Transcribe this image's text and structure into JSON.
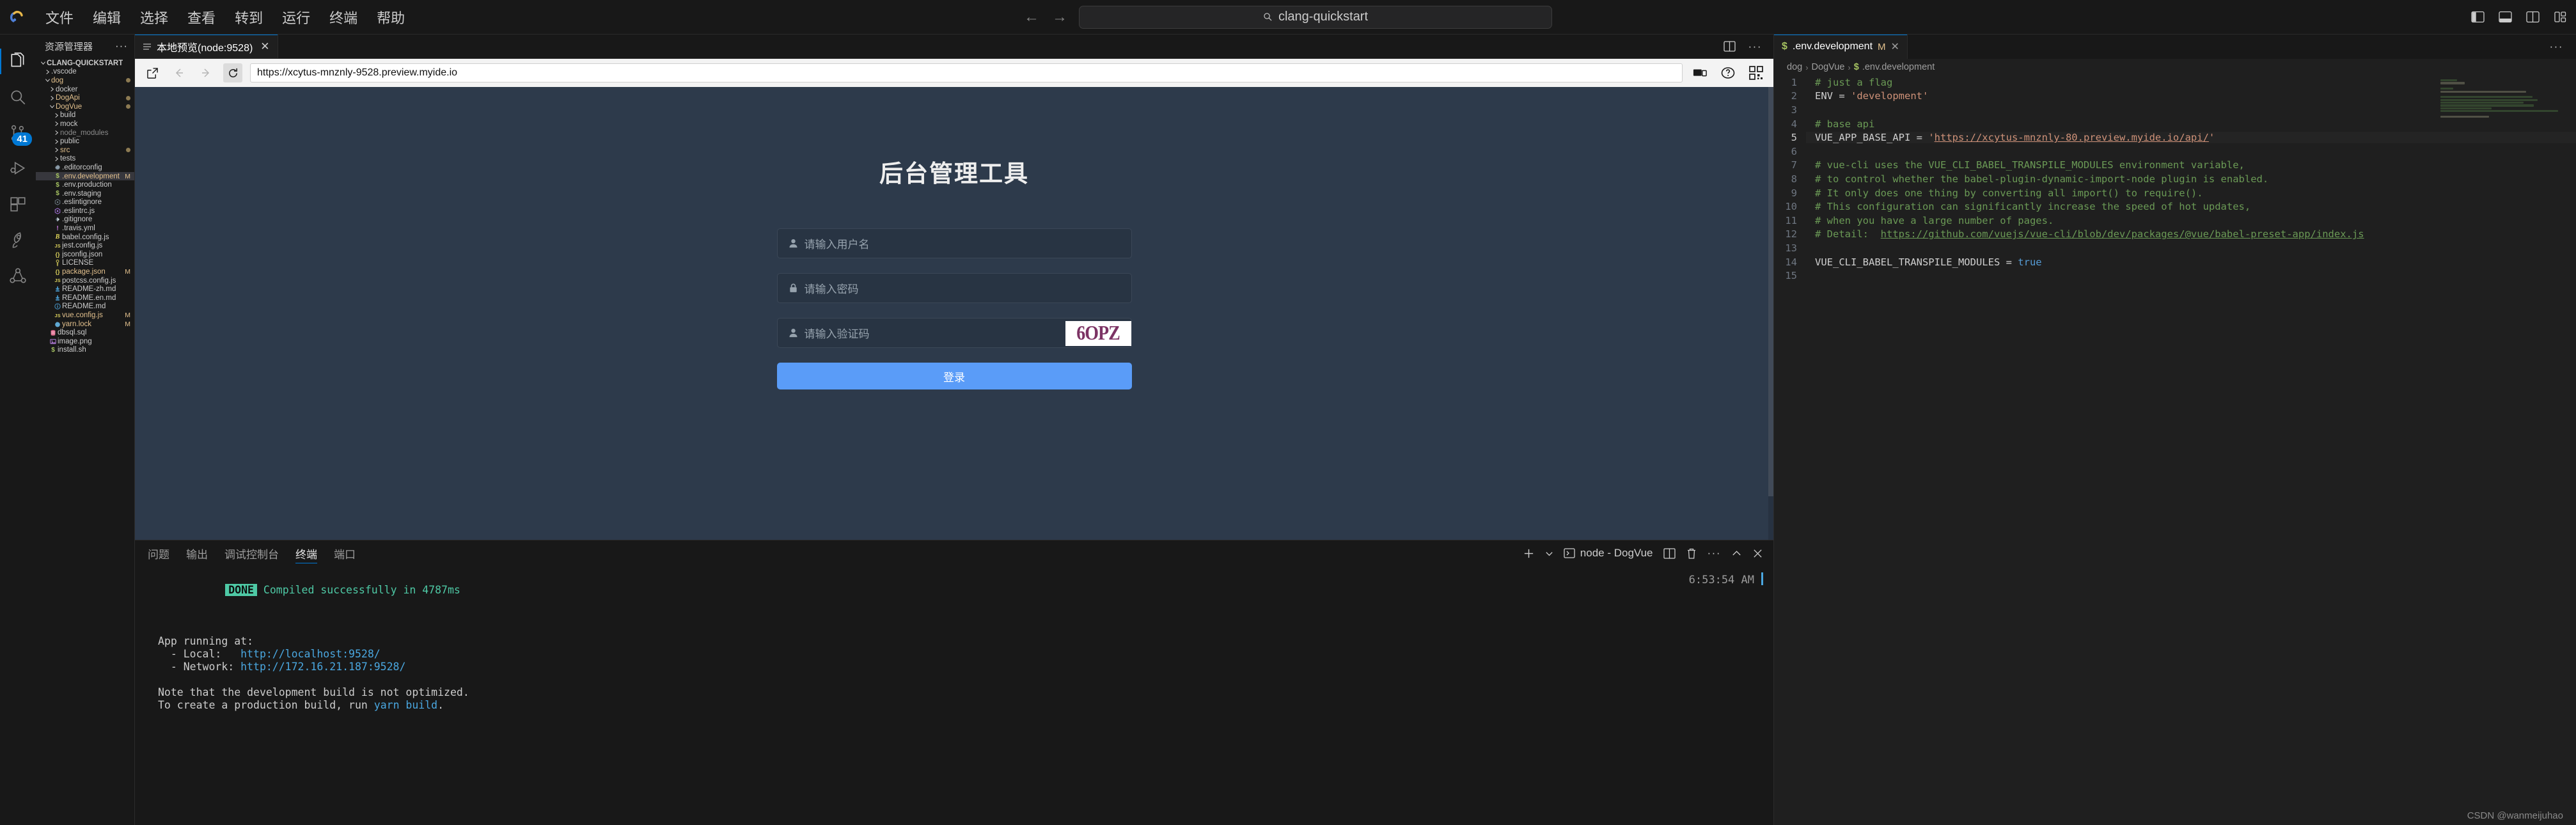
{
  "titlebar": {
    "menus": [
      "文件",
      "编辑",
      "选择",
      "查看",
      "转到",
      "运行",
      "终端",
      "帮助"
    ],
    "search_value": "clang-quickstart",
    "back_icon": "arrow-left-icon",
    "forward_icon": "arrow-right-icon",
    "search_icon": "search-icon",
    "layout_icons": [
      "toggle-primary-sidebar-icon",
      "toggle-panel-icon",
      "toggle-secondary-sidebar-icon",
      "customize-layout-icon"
    ]
  },
  "activitybar": {
    "items": [
      {
        "name": "explorer",
        "icon": "files-icon",
        "active": true,
        "badge": ""
      },
      {
        "name": "search",
        "icon": "search-icon",
        "active": false,
        "badge": ""
      },
      {
        "name": "source-control",
        "icon": "source-control-icon",
        "active": false,
        "badge": "41"
      },
      {
        "name": "run-debug",
        "icon": "run-debug-icon",
        "active": false,
        "badge": ""
      },
      {
        "name": "extensions",
        "icon": "extensions-icon",
        "active": false,
        "badge": ""
      },
      {
        "name": "deploy",
        "icon": "rocket-icon",
        "active": false,
        "badge": ""
      },
      {
        "name": "share",
        "icon": "share-network-icon",
        "active": false,
        "badge": ""
      }
    ]
  },
  "sidebar": {
    "header": "资源管理器",
    "more_icon": "ellipsis-icon",
    "root": "CLANG-QUICKSTART",
    "tree": [
      {
        "label": ".vscode",
        "indent": 1,
        "type": "folder",
        "expanded": false,
        "icon": "chevron-right-icon",
        "color": "white",
        "status": "",
        "dot": ""
      },
      {
        "label": "dog",
        "indent": 1,
        "type": "folder",
        "expanded": true,
        "icon": "chevron-down-icon",
        "color": "orange",
        "status": "",
        "dot": "#8c7a52"
      },
      {
        "label": "docker",
        "indent": 2,
        "type": "folder",
        "expanded": false,
        "icon": "chevron-right-icon",
        "color": "white",
        "status": "",
        "dot": ""
      },
      {
        "label": "DogApi",
        "indent": 2,
        "type": "folder",
        "expanded": false,
        "icon": "chevron-right-icon",
        "color": "orange",
        "status": "",
        "dot": "#8c7a52"
      },
      {
        "label": "DogVue",
        "indent": 2,
        "type": "folder",
        "expanded": true,
        "icon": "chevron-down-icon",
        "color": "orange",
        "status": "",
        "dot": "#8c7a52"
      },
      {
        "label": "build",
        "indent": 3,
        "type": "folder",
        "expanded": false,
        "icon": "chevron-right-icon",
        "color": "white",
        "status": "",
        "dot": ""
      },
      {
        "label": "mock",
        "indent": 3,
        "type": "folder",
        "expanded": false,
        "icon": "chevron-right-icon",
        "color": "white",
        "status": "",
        "dot": ""
      },
      {
        "label": "node_modules",
        "indent": 3,
        "type": "folder",
        "expanded": false,
        "icon": "chevron-right-icon",
        "color": "dim",
        "status": "",
        "dot": ""
      },
      {
        "label": "public",
        "indent": 3,
        "type": "folder",
        "expanded": false,
        "icon": "chevron-right-icon",
        "color": "white",
        "status": "",
        "dot": ""
      },
      {
        "label": "src",
        "indent": 3,
        "type": "folder",
        "expanded": false,
        "icon": "chevron-right-icon",
        "color": "orange",
        "status": "",
        "dot": "#8c7a52"
      },
      {
        "label": "tests",
        "indent": 3,
        "type": "folder",
        "expanded": false,
        "icon": "chevron-right-icon",
        "color": "white",
        "status": "",
        "dot": ""
      },
      {
        "label": ".editorconfig",
        "indent": 3,
        "type": "file",
        "icon": "gear-file-icon",
        "color": "white",
        "status": "",
        "dot": ""
      },
      {
        "label": ".env.development",
        "indent": 3,
        "type": "file",
        "icon": "env-file-icon",
        "color": "orange",
        "status": "M",
        "selected": true,
        "dot": ""
      },
      {
        "label": ".env.production",
        "indent": 3,
        "type": "file",
        "icon": "env-file-icon",
        "color": "white",
        "status": "",
        "dot": ""
      },
      {
        "label": ".env.staging",
        "indent": 3,
        "type": "file",
        "icon": "env-file-icon",
        "color": "white",
        "status": "",
        "dot": ""
      },
      {
        "label": ".eslintignore",
        "indent": 3,
        "type": "file",
        "icon": "eslint-ignore-icon",
        "color": "white",
        "status": "",
        "dot": ""
      },
      {
        "label": ".eslintrc.js",
        "indent": 3,
        "type": "file",
        "icon": "eslint-icon",
        "color": "white",
        "status": "",
        "dot": ""
      },
      {
        "label": ".gitignore",
        "indent": 3,
        "type": "file",
        "icon": "git-icon",
        "color": "white",
        "status": "",
        "dot": ""
      },
      {
        "label": ".travis.yml",
        "indent": 3,
        "type": "file",
        "icon": "travis-icon",
        "color": "white",
        "status": "",
        "dot": ""
      },
      {
        "label": "babel.config.js",
        "indent": 3,
        "type": "file",
        "icon": "babel-icon",
        "color": "white",
        "status": "",
        "dot": ""
      },
      {
        "label": "jest.config.js",
        "indent": 3,
        "type": "file",
        "icon": "js-icon",
        "color": "white",
        "status": "",
        "dot": ""
      },
      {
        "label": "jsconfig.json",
        "indent": 3,
        "type": "file",
        "icon": "json-icon",
        "color": "white",
        "status": "",
        "dot": ""
      },
      {
        "label": "LICENSE",
        "indent": 3,
        "type": "file",
        "icon": "license-icon",
        "color": "white",
        "status": "",
        "dot": ""
      },
      {
        "label": "package.json",
        "indent": 3,
        "type": "file",
        "icon": "json-icon",
        "color": "orange",
        "status": "M",
        "dot": ""
      },
      {
        "label": "postcss.config.js",
        "indent": 3,
        "type": "file",
        "icon": "js-icon",
        "color": "white",
        "status": "",
        "dot": ""
      },
      {
        "label": "README-zh.md",
        "indent": 3,
        "type": "file",
        "icon": "markdown-icon",
        "color": "white",
        "status": "",
        "dot": ""
      },
      {
        "label": "README.en.md",
        "indent": 3,
        "type": "file",
        "icon": "markdown-icon",
        "color": "white",
        "status": "",
        "dot": ""
      },
      {
        "label": "README.md",
        "indent": 3,
        "type": "file",
        "icon": "info-icon",
        "color": "white",
        "status": "",
        "dot": ""
      },
      {
        "label": "vue.config.js",
        "indent": 3,
        "type": "file",
        "icon": "js-icon",
        "color": "orange",
        "status": "M",
        "dot": ""
      },
      {
        "label": "yarn.lock",
        "indent": 3,
        "type": "file",
        "icon": "yarn-icon",
        "color": "orange",
        "status": "M",
        "dot": ""
      },
      {
        "label": "dbsql.sql",
        "indent": 2,
        "type": "file",
        "icon": "database-icon",
        "color": "white",
        "status": "",
        "dot": ""
      },
      {
        "label": "image.png",
        "indent": 2,
        "type": "file",
        "icon": "image-icon",
        "color": "white",
        "status": "",
        "dot": ""
      },
      {
        "label": "install.sh",
        "indent": 2,
        "type": "file",
        "icon": "shell-icon",
        "color": "white",
        "status": "",
        "dot": ""
      }
    ]
  },
  "preview": {
    "tab_label": "本地预览(node:9528)",
    "tab_icon": "preview-list-icon",
    "tab_close_icon": "close-icon",
    "split_icon": "split-editor-icon",
    "more_icon": "ellipsis-icon",
    "toolbar": {
      "open_external_icon": "open-external-icon",
      "back_icon": "arrow-left-icon",
      "forward_icon": "arrow-right-icon",
      "reload_icon": "reload-icon",
      "url": "https://xcytus-mnznly-9528.preview.myide.io",
      "device_icon": "device-toggle-icon",
      "help_icon": "question-circle-icon",
      "qr_icon": "qr-code-icon"
    },
    "page": {
      "title": "后台管理工具",
      "fields": [
        {
          "name": "username",
          "icon": "user-icon",
          "placeholder": "请输入用户名",
          "value": ""
        },
        {
          "name": "password",
          "icon": "lock-icon",
          "placeholder": "请输入密码",
          "value": ""
        },
        {
          "name": "captcha",
          "icon": "user-icon",
          "placeholder": "请输入验证码",
          "value": ""
        }
      ],
      "captcha_text": "6OPZ",
      "submit_label": "登录",
      "accent_color": "#5a9cf8",
      "bg_color": "#2d3a4b"
    }
  },
  "panel": {
    "tabs": [
      {
        "label": "问题",
        "active": false
      },
      {
        "label": "输出",
        "active": false
      },
      {
        "label": "调试控制台",
        "active": false
      },
      {
        "label": "终端",
        "active": true
      },
      {
        "label": "端口",
        "active": false
      }
    ],
    "controls": {
      "add_icon": "plus-icon",
      "dropdown_icon": "chevron-down-icon",
      "terminal_icon": "terminal-icon",
      "terminal_name": "node - DogVue",
      "split_icon": "split-panel-icon",
      "trash_icon": "trash-icon",
      "more_icon": "ellipsis-icon",
      "collapse_icon": "chevron-up-icon",
      "close_icon": "close-icon"
    },
    "terminal": {
      "done_badge": "DONE",
      "done_text": "Compiled successfully in 4787ms",
      "running_label": "App running at:",
      "local_label": "  - Local:   ",
      "local_url": "http://localhost:9528/",
      "network_label": "  - Network: ",
      "network_url": "http://172.16.21.187:9528/",
      "note1": "Note that the development build is not optimized.",
      "note2_pre": "To create a production build, run ",
      "note2_cmd": "yarn build",
      "note2_post": ".",
      "time": "6:53:54 AM"
    }
  },
  "editor": {
    "tab": {
      "label": ".env.development",
      "icon": "env-file-icon",
      "status": "M",
      "close_icon": "close-icon"
    },
    "more_icon": "ellipsis-icon",
    "breadcrumb": [
      "dog",
      "DogVue",
      ".env.development"
    ],
    "current_line": 5,
    "lines": [
      {
        "n": 1,
        "segments": [
          {
            "t": "# just a flag",
            "c": "c-comment"
          }
        ]
      },
      {
        "n": 2,
        "segments": [
          {
            "t": "ENV",
            "c": "c-var"
          },
          {
            "t": " = ",
            "c": "c-op"
          },
          {
            "t": "'development'",
            "c": "c-str"
          }
        ]
      },
      {
        "n": 3,
        "segments": []
      },
      {
        "n": 4,
        "segments": [
          {
            "t": "# base api",
            "c": "c-comment"
          }
        ]
      },
      {
        "n": 5,
        "segments": [
          {
            "t": "VUE_APP_BASE_API",
            "c": "c-var"
          },
          {
            "t": " = ",
            "c": "c-op"
          },
          {
            "t": "'",
            "c": "c-str"
          },
          {
            "t": "https://xcytus-mnznly-80.preview.myide.io/api/",
            "c": "c-link"
          },
          {
            "t": "'",
            "c": "c-str"
          }
        ],
        "modified": true
      },
      {
        "n": 6,
        "segments": []
      },
      {
        "n": 7,
        "segments": [
          {
            "t": "# vue-cli uses the VUE_CLI_BABEL_TRANSPILE_MODULES environment variable,",
            "c": "c-comment"
          }
        ]
      },
      {
        "n": 8,
        "segments": [
          {
            "t": "# to control whether the babel-plugin-dynamic-import-node plugin is enabled.",
            "c": "c-comment"
          }
        ]
      },
      {
        "n": 9,
        "segments": [
          {
            "t": "# It only does one thing by converting all import() to require().",
            "c": "c-comment"
          }
        ]
      },
      {
        "n": 10,
        "segments": [
          {
            "t": "# This configuration can significantly increase the speed of hot updates,",
            "c": "c-comment"
          }
        ]
      },
      {
        "n": 11,
        "segments": [
          {
            "t": "# when you have a large number of pages.",
            "c": "c-comment"
          }
        ]
      },
      {
        "n": 12,
        "segments": [
          {
            "t": "# Detail:  ",
            "c": "c-comment"
          },
          {
            "t": "https://github.com/vuejs/vue-cli/blob/dev/packages/@vue/babel-preset-app/index.js",
            "c": "c-link2"
          }
        ]
      },
      {
        "n": 13,
        "segments": []
      },
      {
        "n": 14,
        "segments": [
          {
            "t": "VUE_CLI_BABEL_TRANSPILE_MODULES",
            "c": "c-var"
          },
          {
            "t": " = ",
            "c": "c-op"
          },
          {
            "t": "true",
            "c": "c-kw"
          }
        ]
      },
      {
        "n": 15,
        "segments": []
      }
    ]
  },
  "watermark": "CSDN @wanmeijuhao"
}
